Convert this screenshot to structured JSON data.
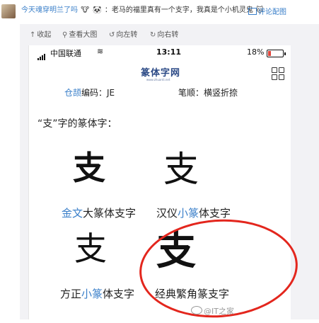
{
  "comment": {
    "username": "今天魂穿明兰了吗",
    "emoji1": "🐮",
    "emoji2": "🐼",
    "text": "：老马的福里真有一个支字，我真是个小机灵鬼",
    "emoji3": "🐱",
    "action_view_pic": "评论配图"
  },
  "toolbar": {
    "collapse": "收起",
    "view_large": "查看大图",
    "rotate_left": "向左转",
    "rotate_right": "向右转"
  },
  "phone": {
    "carrier": "中国联通",
    "time": "13:11",
    "battery": "18%",
    "battery_level": 0.18,
    "site_logo": "篆体字网",
    "site_logo_sub": "www.zhuanti.net",
    "cangjie_part": "仓颉",
    "cangjie_rest": "编码：JE",
    "strokes": "笔顺：横竖折捺",
    "section_title": "“支”字的篆体字：",
    "glyphs": [
      "支",
      "支",
      "支",
      "支"
    ],
    "captions": [
      {
        "p1": "金文",
        "p2": "大篆体支字"
      },
      {
        "p1": "汉仪",
        "p2": "小篆",
        "p3": "体支字"
      },
      {
        "p1": "方正",
        "p2": "小篆",
        "p3": "体支字"
      },
      {
        "p1": "经典繁角篆支字"
      }
    ]
  },
  "watermark": "@IT之家",
  "colors": {
    "link_blue": "#3a7fc9",
    "annotation_red": "#e3261d",
    "battery_red": "#e0443a"
  }
}
